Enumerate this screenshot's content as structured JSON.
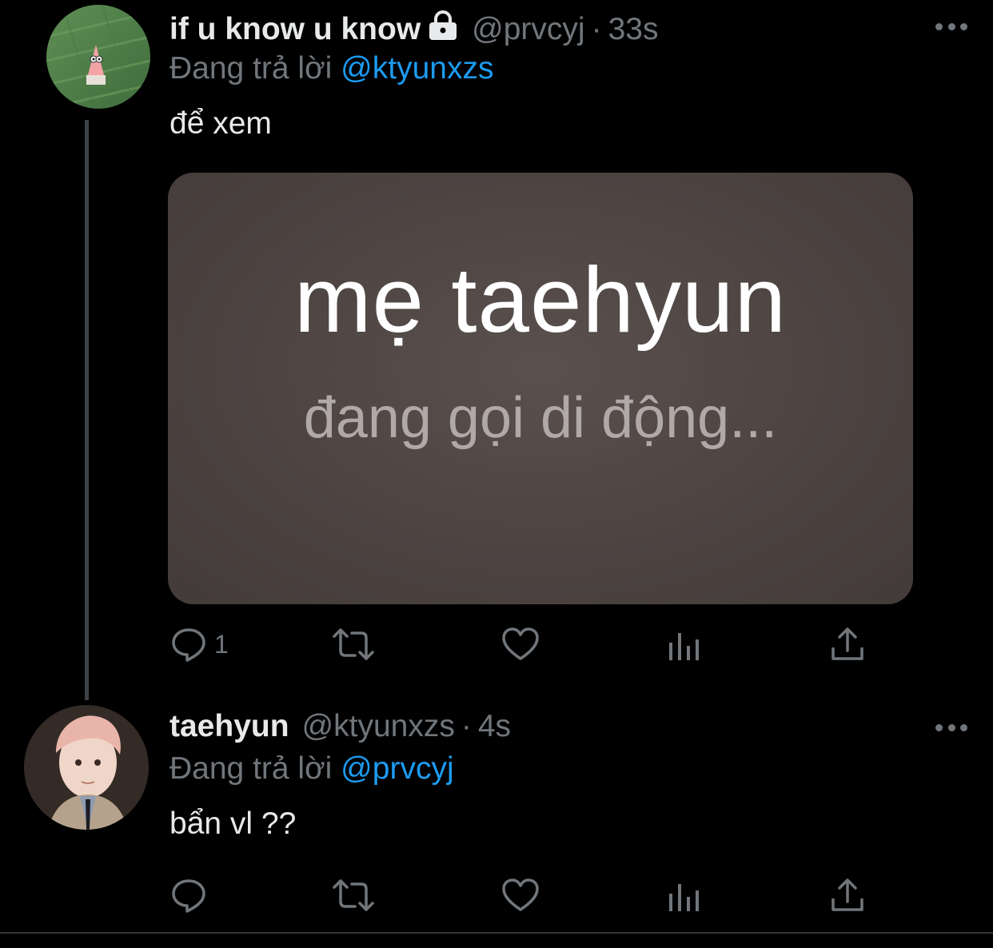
{
  "tweets": [
    {
      "display_name": "if u know u know",
      "handle": "@prvcyj",
      "separator": "·",
      "time": "33s",
      "reply_prefix": "Đang trả lời",
      "reply_mention": "@ktyunxzs",
      "text": "để xem",
      "media": {
        "line1": "mẹ taehyun",
        "line2": "đang gọi di động..."
      },
      "reply_count": "1"
    },
    {
      "display_name": "taehyun",
      "handle": "@ktyunxzs",
      "separator": "·",
      "time": "4s",
      "reply_prefix": "Đang trả lời",
      "reply_mention": "@prvcyj",
      "text": "bẩn vl ??",
      "reply_count": ""
    }
  ],
  "colors": {
    "background": "#000000",
    "primary_text": "#e7e9ea",
    "secondary_text": "#71767b",
    "mention": "#1d9bf0"
  }
}
